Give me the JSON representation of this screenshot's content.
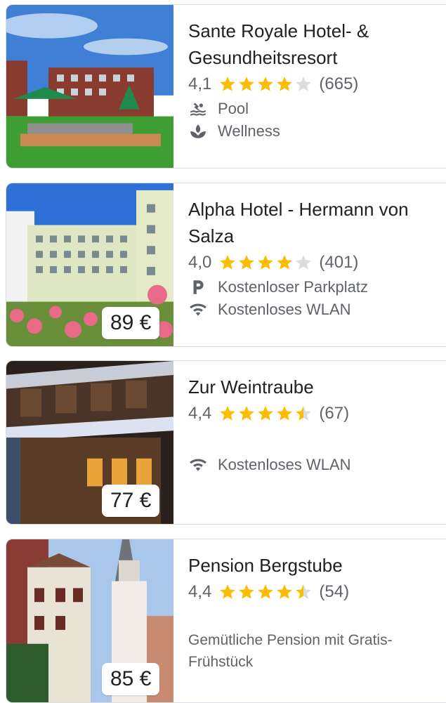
{
  "hotels": [
    {
      "name": "Sante Royale Hotel- & Gesundheitsresort",
      "rating": "4,1",
      "stars": 4.1,
      "reviews": "(665)",
      "amenities": [
        {
          "icon": "pool-icon",
          "label": "Pool"
        },
        {
          "icon": "wellness-icon",
          "label": "Wellness"
        }
      ]
    },
    {
      "name": "Alpha Hotel - Hermann von Salza",
      "rating": "4,0",
      "stars": 4.0,
      "reviews": "(401)",
      "price": "89 €",
      "amenities": [
        {
          "icon": "parking-icon",
          "label": "Kostenloser Parkplatz"
        },
        {
          "icon": "wifi-icon",
          "label": "Kostenloses WLAN"
        }
      ]
    },
    {
      "name": "Zur Weintraube",
      "rating": "4,4",
      "stars": 4.4,
      "reviews": "(67)",
      "price": "77 €",
      "amenities": [
        {
          "icon": "wifi-icon",
          "label": "Kostenloses WLAN"
        }
      ]
    },
    {
      "name": "Pension Bergstube",
      "rating": "4,4",
      "stars": 4.4,
      "reviews": "(54)",
      "price": "85 €",
      "description": "Gemütliche Pension mit Gratis-Frühstück"
    }
  ],
  "colors": {
    "star": "#fbbc04",
    "star_empty": "#dadce0",
    "text_secondary": "#5f6368"
  }
}
